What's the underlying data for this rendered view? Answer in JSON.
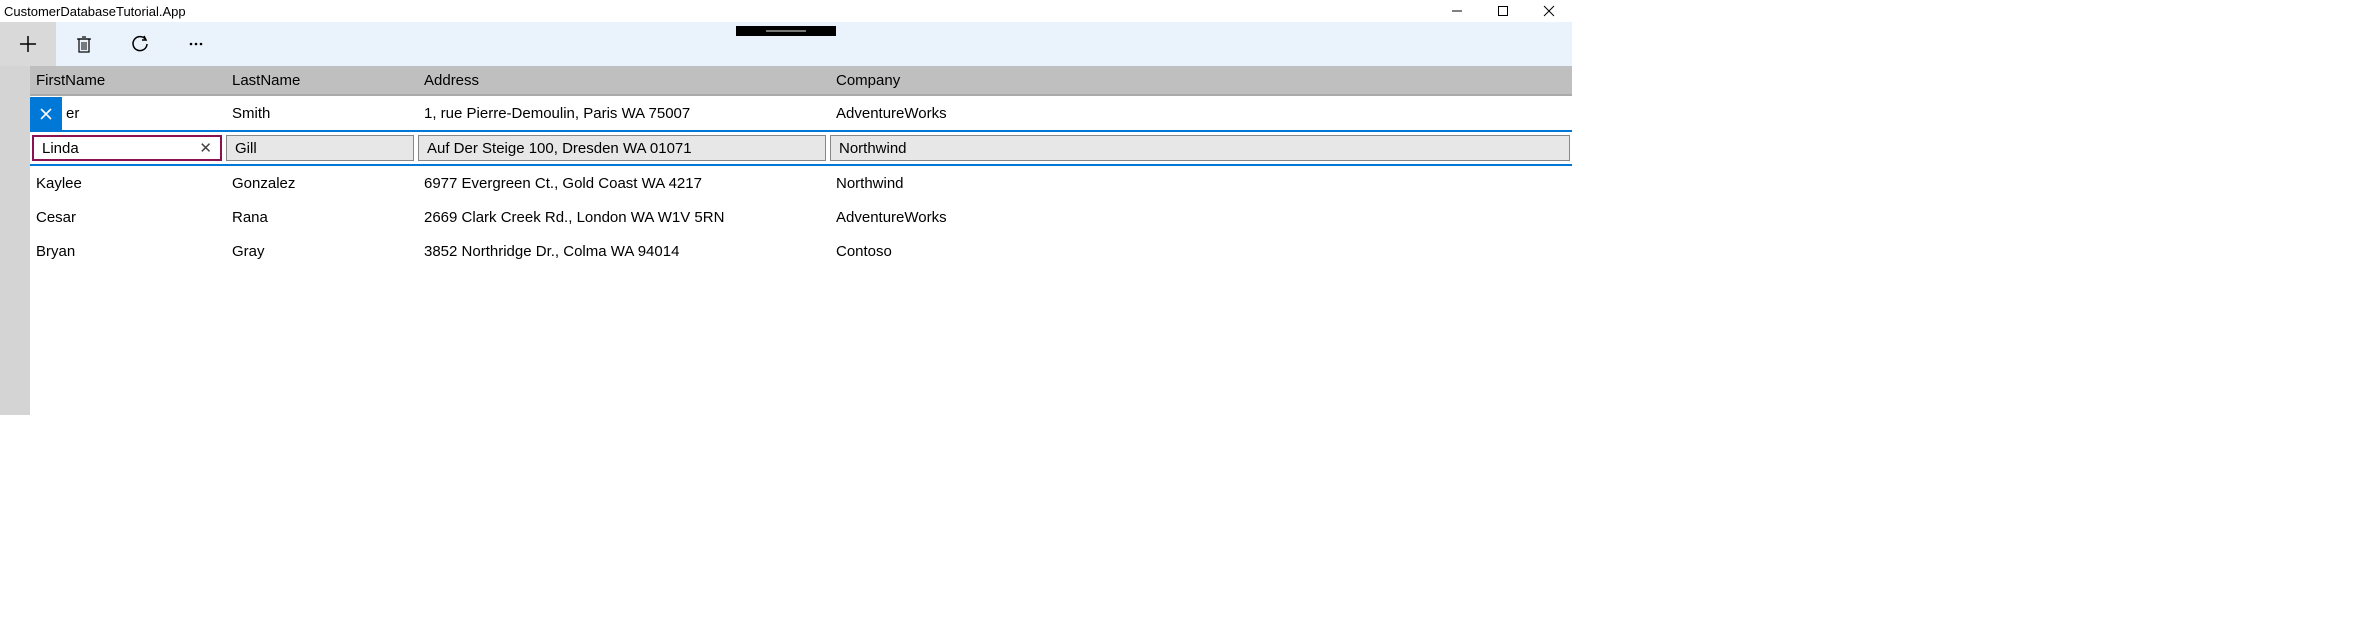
{
  "window": {
    "title": "CustomerDatabaseTutorial.App"
  },
  "commands": {
    "add": "add",
    "delete": "delete",
    "refresh": "refresh",
    "more": "more"
  },
  "columns": {
    "firstName": "FirstName",
    "lastName": "LastName",
    "address": "Address",
    "company": "Company"
  },
  "rows": [
    {
      "firstName": "er",
      "lastName": "Smith",
      "address": "1, rue Pierre-Demoulin, Paris WA 75007",
      "company": "AdventureWorks"
    },
    {
      "firstName": "Linda",
      "lastName": "Gill",
      "address": "Auf Der Steige 100, Dresden WA 01071",
      "company": "Northwind"
    },
    {
      "firstName": "Kaylee",
      "lastName": "Gonzalez",
      "address": "6977 Evergreen Ct., Gold Coast WA 4217",
      "company": "Northwind"
    },
    {
      "firstName": "Cesar",
      "lastName": "Rana",
      "address": "2669 Clark Creek Rd., London WA W1V 5RN",
      "company": "AdventureWorks"
    },
    {
      "firstName": "Bryan",
      "lastName": "Gray",
      "address": "3852 Northridge Dr., Colma WA 94014",
      "company": "Contoso"
    }
  ]
}
